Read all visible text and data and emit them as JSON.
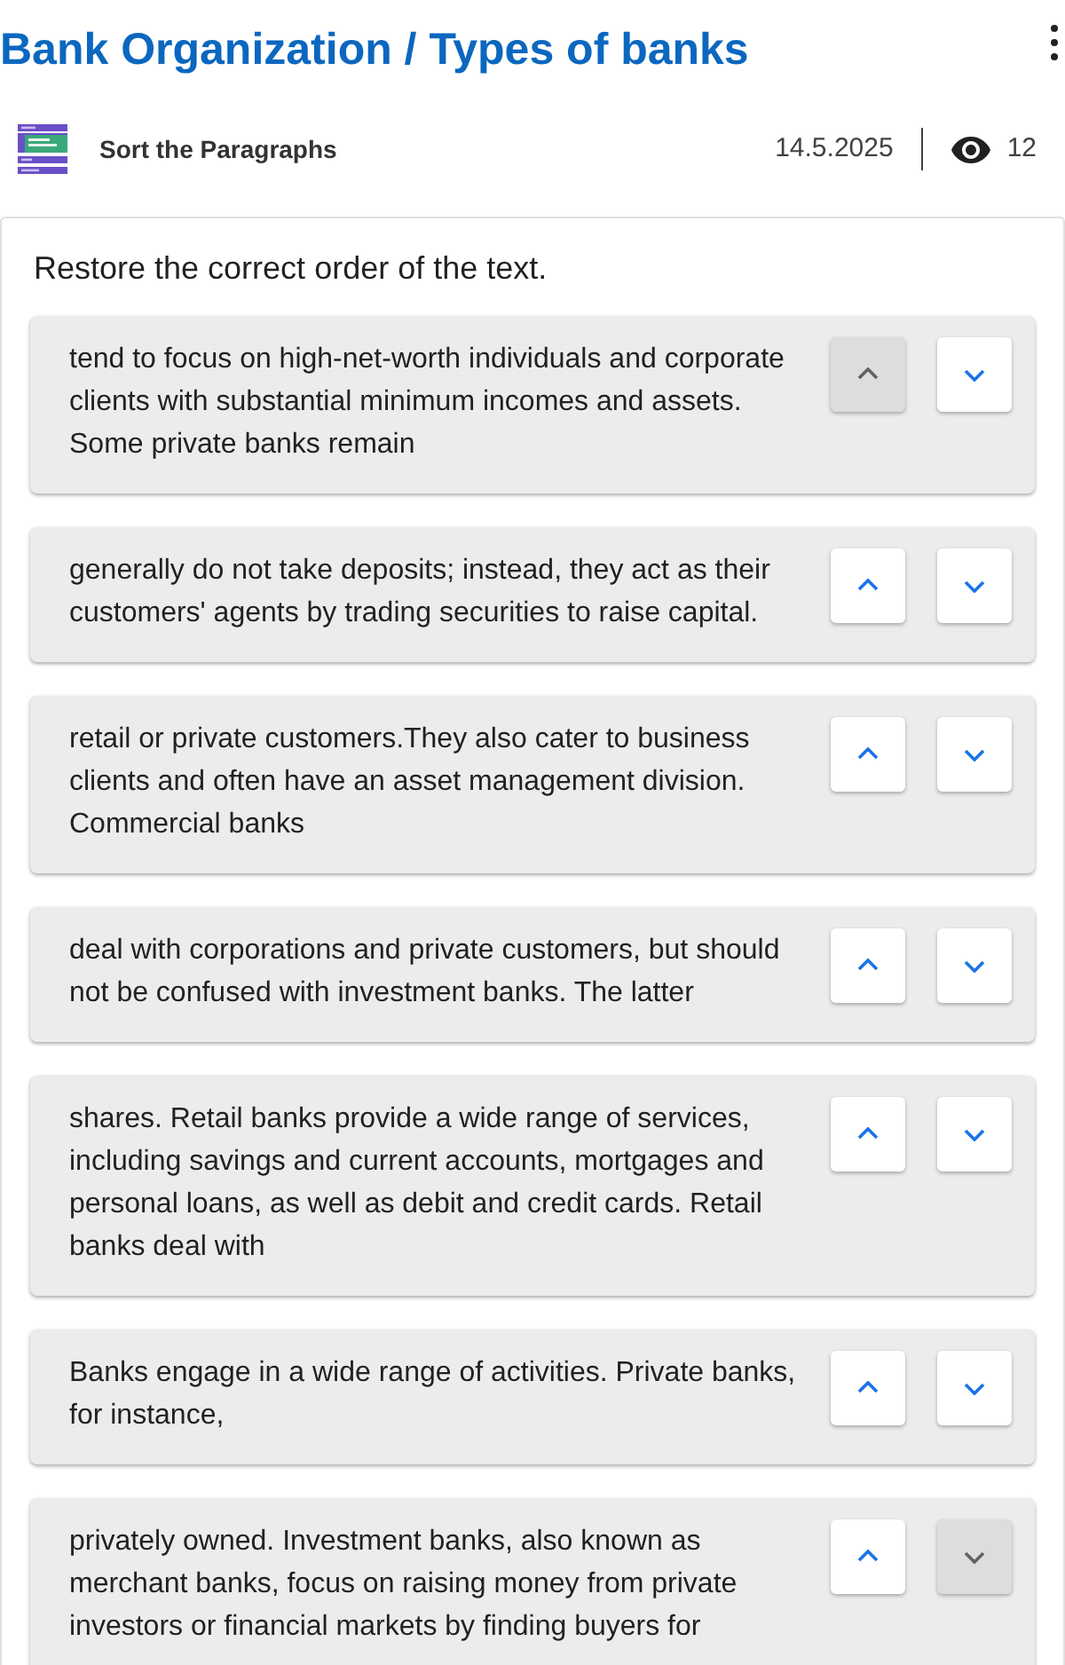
{
  "header": {
    "title": "Bank Organization / Types of banks"
  },
  "meta": {
    "activity_type": "Sort the Paragraphs",
    "date": "14.5.2025",
    "views": "12"
  },
  "task": {
    "instruction": "Restore the correct order of the text.",
    "paragraphs": [
      {
        "text": "tend to focus on high-net-worth individuals and corporate clients with substantial minimum incomes and assets. Some private banks remain",
        "up_disabled": true,
        "down_disabled": false
      },
      {
        "text": "generally do not take deposits; instead, they act as their customers' agents by trading securities to raise capital.",
        "up_disabled": false,
        "down_disabled": false
      },
      {
        "text": "retail or private customers.They also cater to business clients and often have an asset management division. Commercial banks",
        "up_disabled": false,
        "down_disabled": false
      },
      {
        "text": "deal with corporations and private customers, but should not be confused with investment banks. The latter",
        "up_disabled": false,
        "down_disabled": false
      },
      {
        "text": "shares. Retail banks provide a wide range of services, including savings and current accounts, mortgages and personal loans, as well as debit and credit cards. Retail banks deal with",
        "up_disabled": false,
        "down_disabled": false
      },
      {
        "text": "Banks engage in a wide range of activities. Private banks, for instance,",
        "up_disabled": false,
        "down_disabled": false
      },
      {
        "text": "privately owned. Investment banks, also known as merchant banks, focus on raising money from private investors or financial markets by finding buyers for",
        "up_disabled": false,
        "down_disabled": true
      }
    ]
  }
}
